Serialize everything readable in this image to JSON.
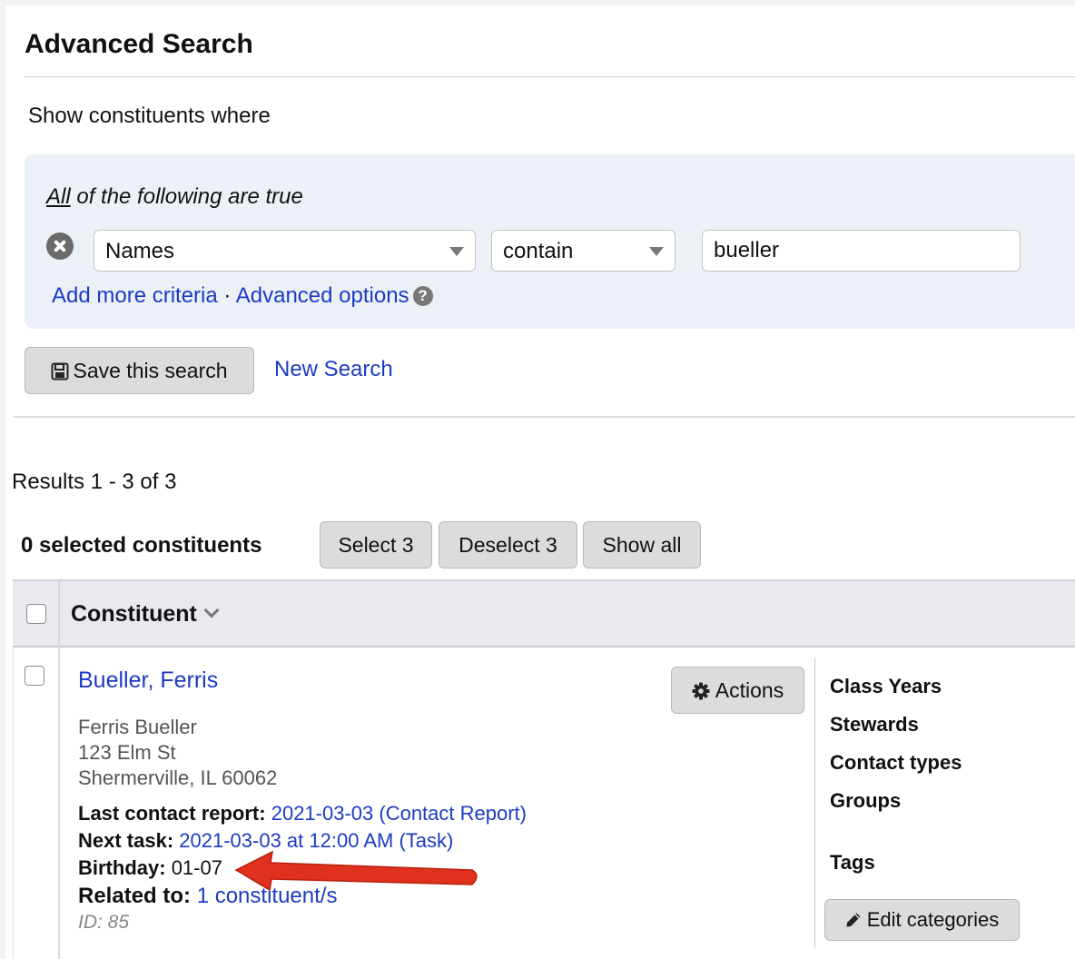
{
  "page": {
    "title": "Advanced Search",
    "subtitle": "Show constituents where"
  },
  "criteria": {
    "quantifier": "All",
    "heading_rest": " of the following are true",
    "row": {
      "field": "Names",
      "operator": "contain",
      "value": "bueller"
    },
    "add_more_label": "Add more criteria",
    "separator": " · ",
    "advanced_options_label": "Advanced options"
  },
  "toolbar": {
    "save_label": "Save this search",
    "new_search_label": "New Search"
  },
  "results": {
    "summary": "Results 1 - 3 of 3",
    "selected_count": "0 selected constituents",
    "select_label": "Select 3",
    "deselect_label": "Deselect 3",
    "show_all_label": "Show all"
  },
  "table": {
    "column_header": "Constituent"
  },
  "record": {
    "name_link": "Bueller, Ferris",
    "actions_label": "Actions",
    "address": [
      "Ferris Bueller",
      "123 Elm St",
      "Shermerville, IL 60062"
    ],
    "last_contact_label": "Last contact report:",
    "last_contact_value": "2021-03-03 (Contact Report)",
    "next_task_label": "Next task:",
    "next_task_value": "2021-03-03 at 12:00 AM (Task)",
    "birthday_label": "Birthday:",
    "birthday_value": "01-07",
    "related_label": "Related to:",
    "related_value": "1 constituent/s",
    "id_text": "ID: 85"
  },
  "categories": {
    "items": [
      "Class Years",
      "Stewards",
      "Contact types",
      "Groups",
      "Tags"
    ],
    "edit_label": "Edit categories"
  },
  "colors": {
    "link": "#1c3bc4",
    "criteria_bg": "#ecf1f8",
    "button_bg": "#dcdcdc",
    "header_bg": "#e8eaf0",
    "annotation_arrow": "#e0301e"
  },
  "icons": {
    "remove_criteria": "x-circle-icon",
    "help": "question-circle-icon",
    "save": "floppy-disk-icon",
    "sort": "chevron-down-icon",
    "actions": "gear-icon",
    "edit": "pencil-icon",
    "annotation": "red-arrow-icon"
  }
}
